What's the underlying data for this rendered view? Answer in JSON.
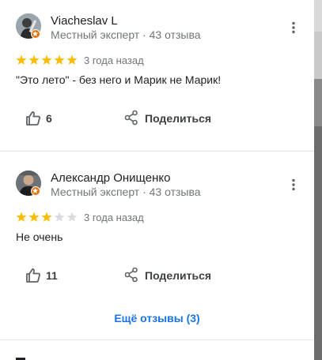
{
  "reviews": [
    {
      "author": "Viacheslav L",
      "meta": "Местный эксперт · 43 отзыва",
      "rating": 5,
      "date": "3 года назад",
      "text": "\"Это лето\" - без него и Марик не Марик!",
      "likes": "6",
      "share_label": "Поделиться"
    },
    {
      "author": "Александр Онищенко",
      "meta": "Местный эксперт · 43 отзыва",
      "rating": 3,
      "date": "3 года назад",
      "text": "Не очень",
      "likes": "11",
      "share_label": "Поделиться"
    }
  ],
  "more_reviews": "Ещё отзывы (3)",
  "colors": {
    "star_filled": "#fbbc04",
    "star_empty": "#dadce0",
    "link": "#1a73e8",
    "badge": "#e8710a"
  },
  "icons": [
    "more-vert-icon",
    "thumb-up-icon",
    "share-icon",
    "star-icon",
    "local-guide-badge-icon"
  ]
}
